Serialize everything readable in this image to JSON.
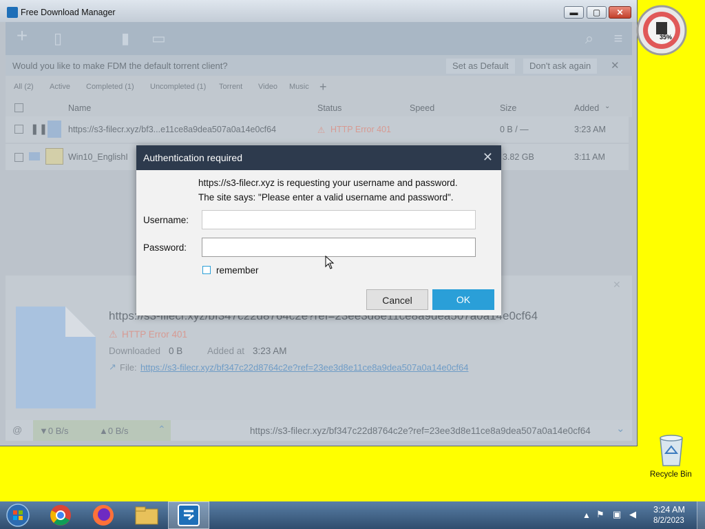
{
  "window": {
    "title": "Free Download Manager",
    "min_glyph": "▬",
    "max_glyph": "▢",
    "close_glyph": "✕"
  },
  "notice": {
    "text": "Would you like to make FDM the default torrent client?",
    "set_default": "Set as Default",
    "dont_ask": "Don't ask again"
  },
  "filters": [
    "All (2)",
    "Active",
    "Completed (1)",
    "Uncompleted (1)",
    "Torrent",
    "Video",
    "Music"
  ],
  "columns": {
    "name": "Name",
    "status": "Status",
    "speed": "Speed",
    "size": "Size",
    "added": "Added"
  },
  "downloads": [
    {
      "name": "https://s3-filecr.xyz/bf3...e11ce8a9dea507a0a14e0cf64",
      "status": "HTTP Error 401",
      "size": "0 B / —",
      "added": "3:23 AM"
    },
    {
      "name": "Win10_EnglishI",
      "status": "",
      "size": "3.82 GB",
      "added": "3:11 AM"
    }
  ],
  "details": {
    "title": "https://s3-filecr.xyz/bf347c22d8764c2e?ref=23ee3d8e11ce8a9dea507a0a14e0cf64",
    "error": "HTTP Error 401",
    "downloaded_label": "Downloaded",
    "downloaded_value": "0 B",
    "added_label": "Added at",
    "added_value": "3:23 AM",
    "file_label": "File:",
    "file_link": "https://s3-filecr.xyz/bf347c22d8764c2e?ref=23ee3d8e11ce8a9dea507a0a14e0cf64"
  },
  "statusbar": {
    "down": "▼0 B/s",
    "up": "▲0 B/s",
    "url": "https://s3-filecr.xyz/bf347c22d8764c2e?ref=23ee3d8e11ce8a9dea507a0a14e0cf64"
  },
  "dialog": {
    "title": "Authentication required",
    "line1": "https://s3-filecr.xyz is requesting your username and password.",
    "line2": "The site says: \"Please enter a valid username and password\".",
    "username_label": "Username:",
    "username_value": "",
    "password_label": "Password:",
    "password_value": "",
    "remember": "remember",
    "cancel": "Cancel",
    "ok": "OK"
  },
  "gadget": {
    "percent": "35%"
  },
  "desktop": {
    "recycle_bin": "Recycle Bin"
  },
  "clock": {
    "time": "3:24 AM",
    "date": "8/2/2023"
  },
  "colors": {
    "accent": "#2a9fd8",
    "error": "#e05a4a",
    "dialog_title": "#2d3a4d",
    "desktop": "#ffff00"
  }
}
